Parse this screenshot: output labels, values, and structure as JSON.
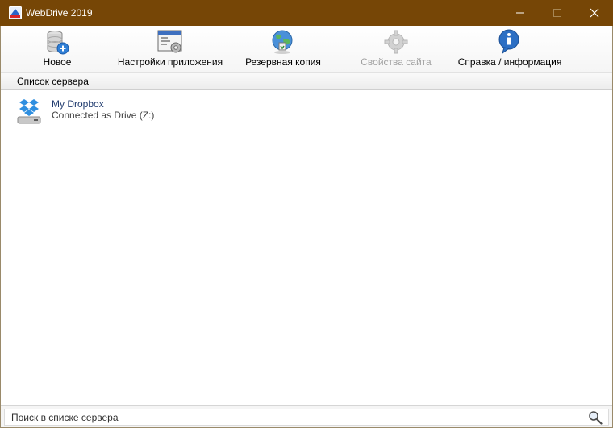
{
  "window": {
    "title": "WebDrive 2019",
    "icons": {
      "app": "webdrive-app-icon",
      "minimize": "minimize-icon",
      "maximize": "maximize-icon",
      "close": "close-icon"
    },
    "colors": {
      "titlebar": "#764606"
    }
  },
  "toolbar": {
    "new_label": "Новое",
    "settings_label": "Настройки приложения",
    "backup_label": "Резервная копия",
    "site_props_label": "Свойства сайта",
    "help_label": "Справка / информация"
  },
  "server_list": {
    "header": "Список сервера",
    "items": [
      {
        "name": "My Dropbox",
        "status": "Connected as Drive (Z:)",
        "icon": "dropbox-drive-icon"
      }
    ]
  },
  "search": {
    "placeholder": "Поиск в списке сервера",
    "icon": "search-icon"
  }
}
